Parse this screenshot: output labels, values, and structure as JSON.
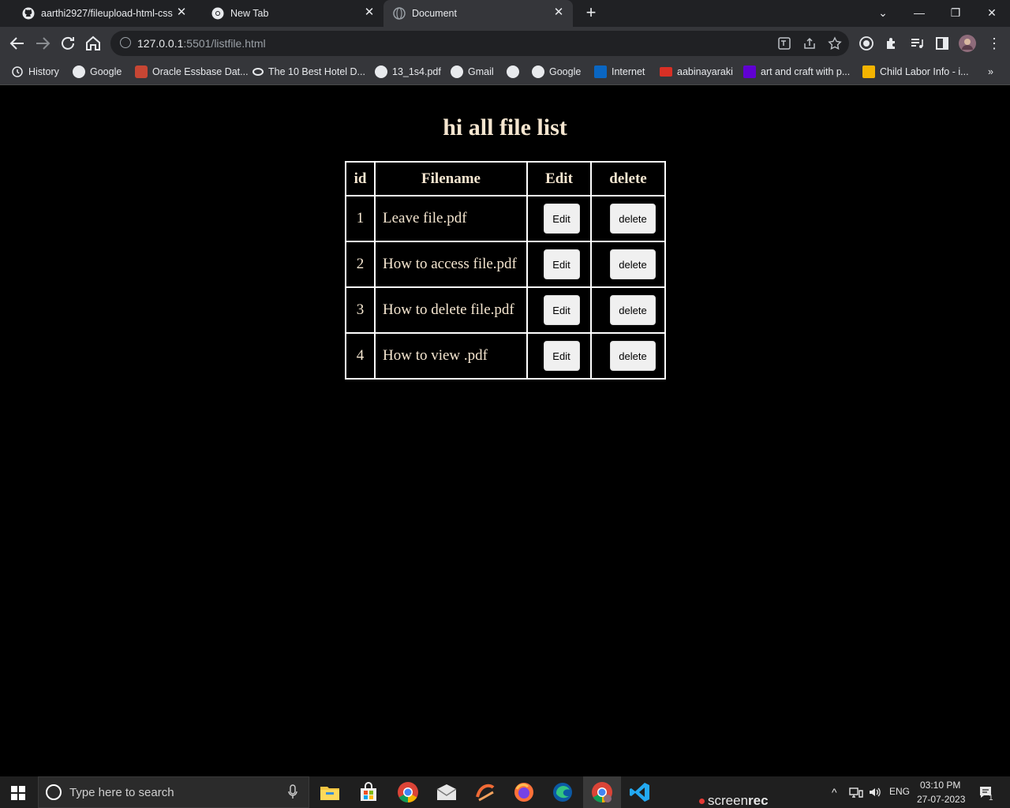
{
  "browser": {
    "tabs": [
      {
        "title": "aarthi2927/fileupload-html-css",
        "icon": "github-icon"
      },
      {
        "title": "New Tab",
        "icon": "chrome-icon"
      },
      {
        "title": "Document",
        "icon": "globe-icon",
        "active": true
      }
    ],
    "url_host": "127.0.0.1",
    "url_rest": ":5501/listfile.html",
    "bookmarks": [
      {
        "label": "History",
        "icon": "history-icon"
      },
      {
        "label": "Google",
        "icon": "google-icon"
      },
      {
        "label": "Oracle Essbase Dat...",
        "icon": "oracle-icon"
      },
      {
        "label": "The 10 Best Hotel D...",
        "icon": "tripadvisor-icon"
      },
      {
        "label": "13_1s4.pdf",
        "icon": "globe-icon"
      },
      {
        "label": "Gmail",
        "icon": "google-icon"
      },
      {
        "label": "",
        "icon": "globe-icon"
      },
      {
        "label": "Google",
        "icon": "google-icon"
      },
      {
        "label": "Internet",
        "icon": "linkedin-icon"
      },
      {
        "label": "aabinayaraki",
        "icon": "gmail-icon"
      },
      {
        "label": "art and craft with p...",
        "icon": "yahoo-icon"
      },
      {
        "label": "Child Labor Info - i...",
        "icon": "bookmark-icon"
      }
    ]
  },
  "page": {
    "title": "hi all file list",
    "headers": {
      "id": "id",
      "filename": "Filename",
      "edit": "Edit",
      "delete": "delete"
    },
    "rows": [
      {
        "id": "1",
        "filename": "Leave file.pdf",
        "edit": "Edit",
        "delete": "delete"
      },
      {
        "id": "2",
        "filename": "How to access file.pdf",
        "edit": "Edit",
        "delete": "delete"
      },
      {
        "id": "3",
        "filename": "How to delete file.pdf",
        "edit": "Edit",
        "delete": "delete"
      },
      {
        "id": "4",
        "filename": "How to view .pdf",
        "edit": "Edit",
        "delete": "delete"
      }
    ]
  },
  "taskbar": {
    "search_placeholder": "Type here to search",
    "screenrec_a": "screen",
    "screenrec_b": "rec",
    "language": "ENG",
    "time": "03:10 PM",
    "date": "27-07-2023",
    "notification_count": "1"
  },
  "colors": {
    "page_bg": "#000000",
    "text": "#f5e6d0",
    "chrome_dark": "#202124",
    "chrome_toolbar": "#35363a",
    "button_bg": "#f0f0f0"
  }
}
